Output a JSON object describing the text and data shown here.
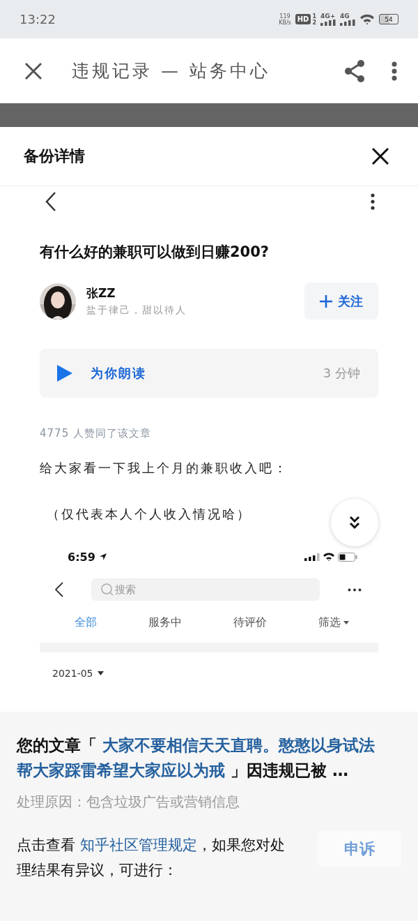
{
  "status_bar": {
    "time": "13:22",
    "speed": "119",
    "speed_unit": "KB/s",
    "hd": "HD",
    "sim_slots": [
      "1",
      "2"
    ],
    "networks": [
      "4G+",
      "4G"
    ],
    "battery": "54"
  },
  "app_bar": {
    "title": "违规记录 — 站务中心"
  },
  "sheet": {
    "title": "备份详情"
  },
  "article": {
    "title": "有什么好的兼职可以做到日赚200?",
    "author": {
      "name": "张ZZ",
      "bio": "盐于律己，甜以待人"
    },
    "follow_label": "关注",
    "read_aloud": {
      "label": "为你朗读",
      "duration": "3 分钟"
    },
    "likes": "4775 人赞同了该文章",
    "paragraphs": [
      "给大家看一下我上个月的兼职收入吧：",
      "（仅代表本人个人收入情况哈）"
    ]
  },
  "embedded_screenshot": {
    "time": "6:59",
    "search_placeholder": "搜索",
    "tabs": [
      {
        "label": "全部",
        "kind": "tab",
        "selected": true
      },
      {
        "label": "服务中",
        "kind": "tab",
        "selected": false
      },
      {
        "label": "待评价",
        "kind": "tab",
        "selected": false
      },
      {
        "label": "筛选",
        "kind": "dropdown",
        "selected": false
      }
    ],
    "month": "2021-05"
  },
  "notice": {
    "prefix": "您的文章「 ",
    "article_title": "大家不要相信天天直聘。憨憨以身试法帮大家踩雷希望大家应以为戒",
    "suffix": " 」因违规已被 …",
    "reason": "处理原因：包含垃圾广告或营销信息",
    "instruction_before": "点击查看 ",
    "rules_link": "知乎社区管理规定",
    "instruction_after": "，如果您对处理结果有异议，可进行：",
    "appeal_label": "申诉"
  }
}
